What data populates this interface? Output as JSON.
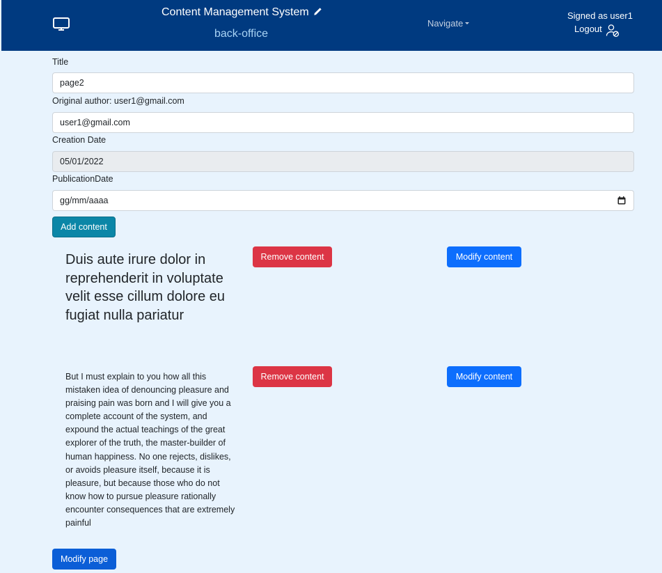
{
  "navbar": {
    "title": "Content Management System",
    "subtitle": "back-office",
    "navigate_label": "Navigate",
    "signed_as": "Signed as user1",
    "logout_label": "Logout"
  },
  "form": {
    "title_label": "Title",
    "title_value": "page2",
    "author_label": "Original author: user1@gmail.com",
    "author_value": "user1@gmail.com",
    "creation_label": "Creation Date",
    "creation_value": "05/01/2022",
    "publication_label": "PublicationDate",
    "publication_placeholder": "gg/mm/aaaa",
    "add_content_label": "Add content"
  },
  "contents": [
    {
      "text": "Duis aute irure dolor in reprehenderit in voluptate velit esse cillum dolore eu fugiat nulla pariatur",
      "remove_label": "Remove content",
      "modify_label": "Modify content"
    },
    {
      "text": "But I must explain to you how all this mistaken idea of denouncing pleasure and praising pain was born and I will give you a complete account of the system, and expound the actual teachings of the great explorer of the truth, the master-builder of human happiness. No one rejects, dislikes, or avoids pleasure itself, because it is pleasure, but because those who do not know how to pursue pleasure rationally encounter consequences that are extremely painful",
      "remove_label": "Remove content",
      "modify_label": "Modify content"
    }
  ],
  "modify_page_label": "Modify page",
  "colors": {
    "navbar": "#003a80",
    "page_bg": "#e8f3fd",
    "info": "#0b86a7",
    "danger": "#dc3545",
    "primary": "#0d6efd"
  },
  "icons": {
    "monitor": "monitor-icon",
    "pencil": "pencil-icon",
    "logout": "user-logout-icon",
    "calendar": "calendar-icon"
  }
}
